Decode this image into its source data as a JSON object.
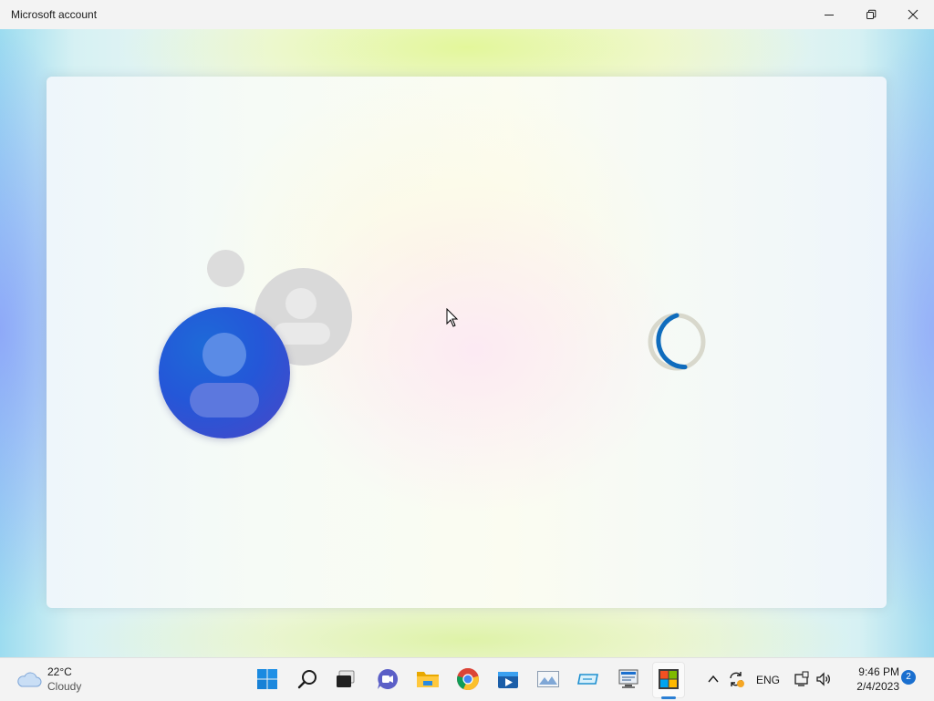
{
  "window": {
    "title": "Microsoft account",
    "controls": [
      "minimize",
      "restore",
      "close"
    ]
  },
  "content": {
    "state": "loading",
    "icons": [
      "account-picture-icon",
      "secondary-account-icon",
      "loading-spinner-icon"
    ]
  },
  "taskbar": {
    "weather": {
      "temperature": "22°C",
      "condition": "Cloudy",
      "icon": "cloud-icon"
    },
    "pinned": [
      "start-icon",
      "search-icon",
      "task-view-icon",
      "chat-icon",
      "file-explorer-icon",
      "chrome-icon",
      "media-player-icon",
      "photos-icon",
      "screen-icon",
      "remote-desktop-icon",
      "microsoft-store-icon"
    ],
    "tray": {
      "language": "ENG",
      "time": "9:46 PM",
      "date": "2/4/2023",
      "notification_count": "2"
    }
  },
  "colors": {
    "accent": "#0f6cbd",
    "spinner_track": "#d8d8cc",
    "avatar_blue": "#2457d8",
    "taskbar_bg": "#f3f3f3"
  }
}
